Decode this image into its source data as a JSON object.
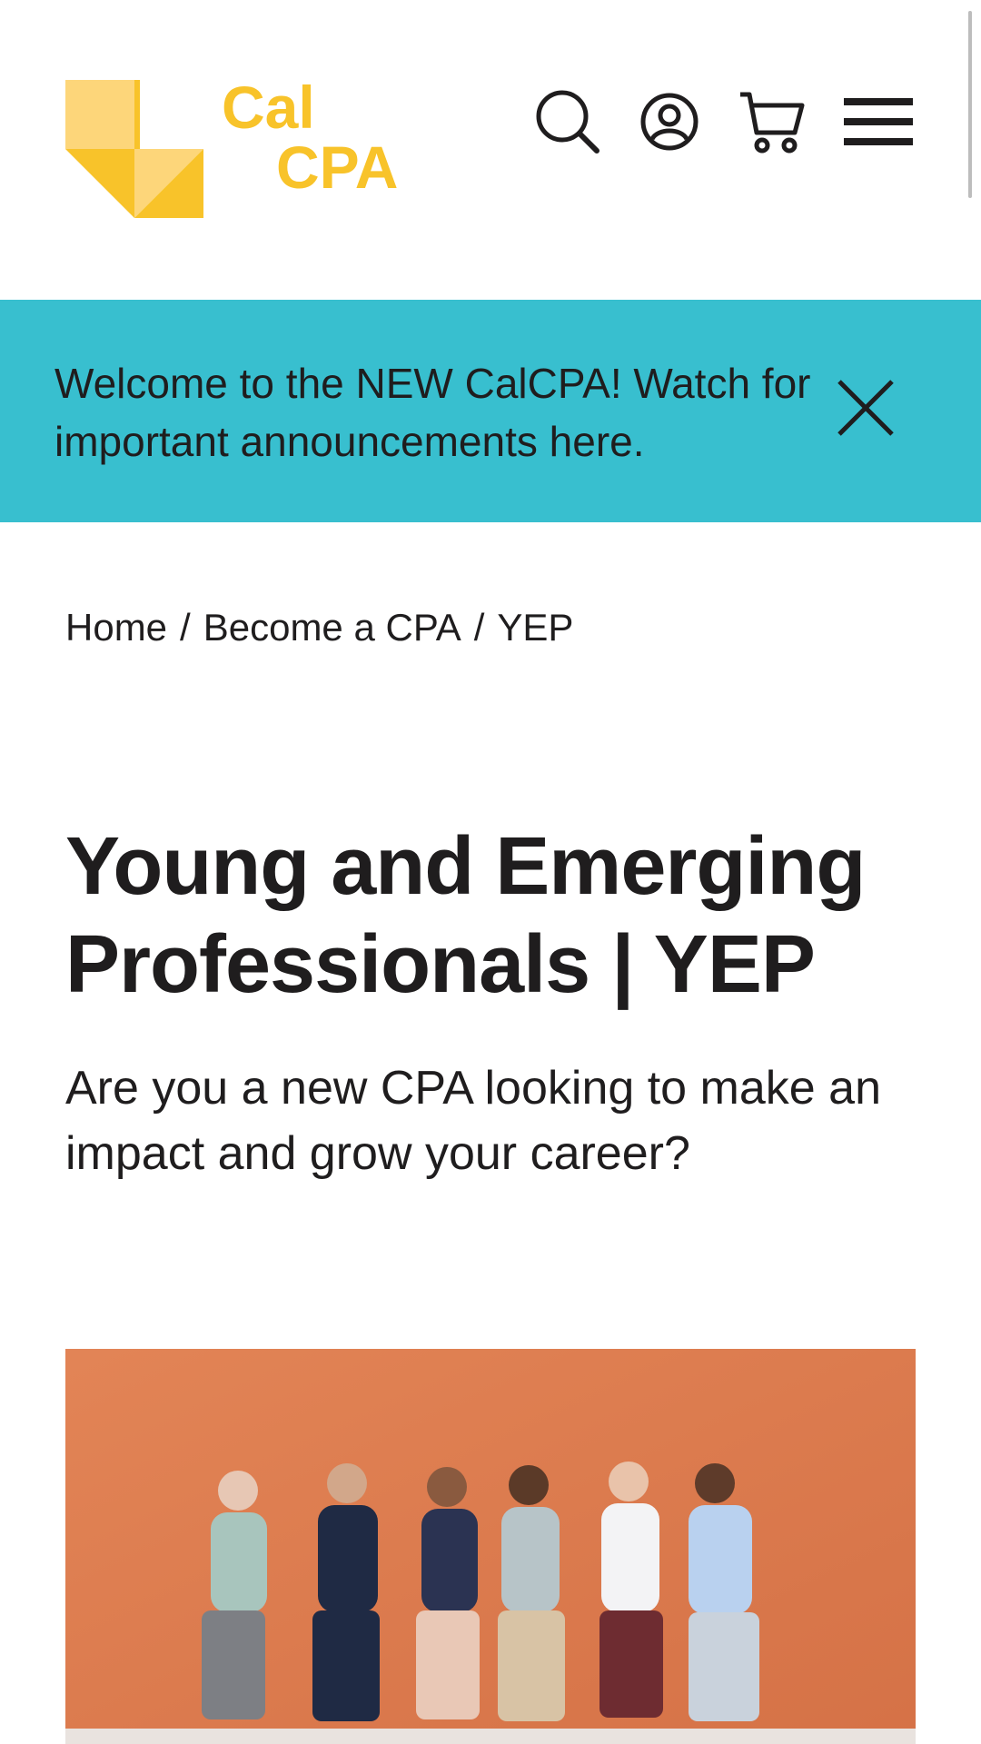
{
  "brand": {
    "logo_line1": "Cal",
    "logo_line2": "CPA",
    "colors": {
      "logo_yellow": "#f8c32a",
      "logo_light": "#fdd67a",
      "banner": "#38bfcf",
      "hero_bg": "#de7a4d",
      "text": "#1f1d1e"
    }
  },
  "header": {
    "icons": [
      "search-icon",
      "account-icon",
      "cart-icon",
      "menu-icon"
    ]
  },
  "announcement": {
    "text": "Welcome to the NEW CalCPA! Watch for important announcements here.",
    "close_icon": "close-icon"
  },
  "breadcrumb": {
    "items": [
      "Home",
      "Become a CPA",
      "YEP"
    ],
    "separator": "/"
  },
  "page": {
    "title": "Young and Emerging Professionals | YEP",
    "subtitle": "Are you a new CPA looking to make an impact and grow your career?"
  },
  "hero": {
    "image": "group-of-young-professionals-photo"
  }
}
